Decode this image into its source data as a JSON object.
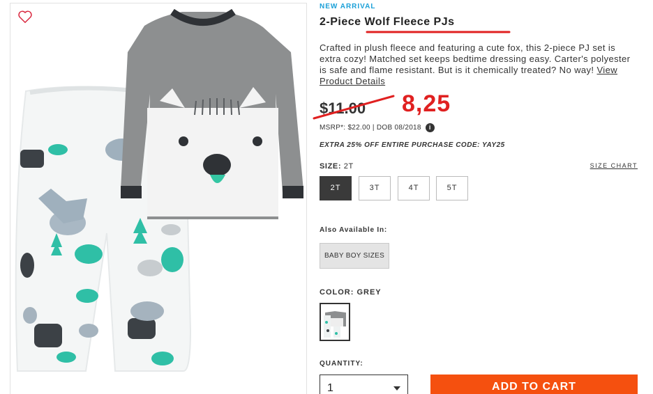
{
  "product": {
    "badge": "NEW ARRIVAL",
    "title": "2-Piece Wolf Fleece PJs",
    "description": "Crafted in plush fleece and featuring a cute fox, this 2-piece PJ set is extra cozy! Matched set keeps bedtime dressing easy. Carter's polyester is safe and flame resistant. But is it chemically treated? No way!",
    "description_link": "View Product Details",
    "price_original": "$11.00",
    "price_annotated": "8,25",
    "msrp": "MSRP*: $22.00 | DOB 08/2018",
    "info_icon": "i",
    "promo": "EXTRA 25% OFF ENTIRE PURCHASE CODE: YAY25"
  },
  "size": {
    "label": "SIZE:",
    "value": "2T",
    "chart_link": "SIZE CHART",
    "options": [
      "2T",
      "3T",
      "4T",
      "5T"
    ],
    "selected_index": 0
  },
  "available": {
    "label": "Also Available In:",
    "option": "BABY BOY SIZES"
  },
  "color": {
    "label": "COLOR: GREY"
  },
  "quantity": {
    "label": "QUANTITY:",
    "value": "1"
  },
  "cart": {
    "button": "ADD TO CART"
  },
  "colors": {
    "accent_blue": "#1aa0d8",
    "annotation_red": "#e02020",
    "cart_orange": "#f5500f",
    "selected_dark": "#3a3a3a"
  },
  "icons": {
    "favorite": "heart-outline-icon",
    "dropdown": "chevron-down-icon",
    "info": "info-icon"
  }
}
